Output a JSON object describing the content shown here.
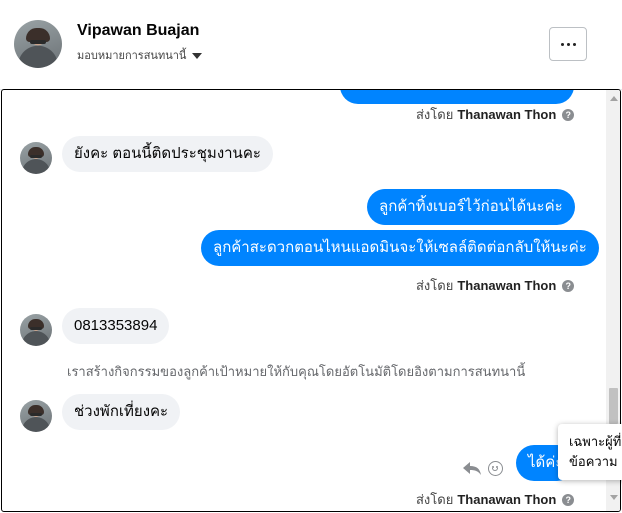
{
  "header": {
    "contact_name": "Vipawan Buajan",
    "assign_label": "มอบหมายการสนทนานี้",
    "more_label": "..."
  },
  "messages": [
    {
      "type": "sent_by",
      "prefix": "ส่งโดย",
      "agent": "Thanawan Thon"
    },
    {
      "type": "incoming",
      "text": "ยังคะ ตอนนี้ติดประชุมงานคะ"
    },
    {
      "type": "outgoing",
      "text": "ลูกค้าทิ้งเบอร์ไว้ก่อนได้นะค่ะ"
    },
    {
      "type": "outgoing",
      "text": "ลูกค้าสะดวกตอนไหนแอดมินจะให้เซลล์ติดต่อกลับให้นะค่ะ"
    },
    {
      "type": "sent_by",
      "prefix": "ส่งโดย",
      "agent": "Thanawan Thon"
    },
    {
      "type": "incoming",
      "text": "0813353894"
    },
    {
      "type": "system",
      "text": "เราสร้างกิจกรรมของลูกค้าเป้าหมายให้กับคุณโดยอัตโนมัติโดยอิงตามการสนทนานี้"
    },
    {
      "type": "incoming",
      "text": "ช่วงพักเที่ยงคะ"
    },
    {
      "type": "outgoing",
      "text": "ได้ค่ะ"
    },
    {
      "type": "sent_by",
      "prefix": "ส่งโดย",
      "agent": "Thanawan Thon"
    }
  ],
  "tooltip": {
    "line1": "เฉพาะผู้ที่",
    "line2": "ข้อความ"
  },
  "icons": {
    "more": "more-horizontal-icon",
    "reply": "reply-icon",
    "react": "emoji-icon",
    "help": "question-icon"
  },
  "colors": {
    "outgoing_bubble": "#0084ff",
    "incoming_bubble": "#f0f2f5"
  }
}
